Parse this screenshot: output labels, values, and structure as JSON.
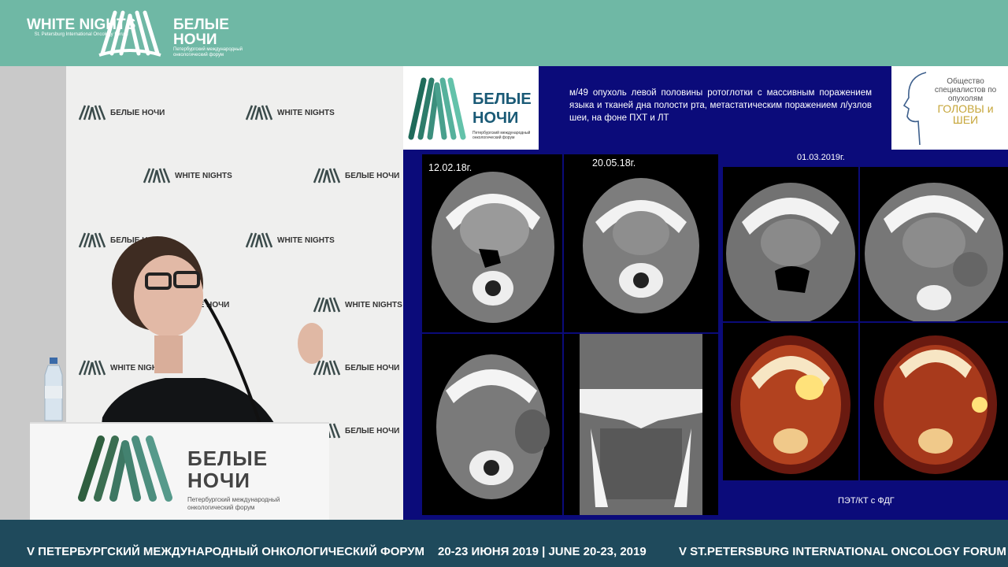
{
  "header": {
    "logo_wn_title": "WHITE NIGHTS",
    "logo_wn_subtitle": "St. Petersburg International Oncology Forum",
    "logo_bn_title": "БЕЛЫЕ НОЧИ",
    "logo_bn_subtitle": "Петербургский международный онкологический форум"
  },
  "stage": {
    "wall_logos": [
      "БЕЛЫЕ НОЧИ",
      "WHITE NIGHTS",
      "WHITE NIGHTS",
      "БЕЛЫЕ НОЧИ",
      "БЕЛЫЕ НОЧИ",
      "WHITE NIGHTS",
      "WHITE NIGHTS",
      "БЕЛЫЕ НОЧИ",
      "WHITE NIGHTS",
      "БЕЛЫЕ НОЧИ",
      "БЕЛЫЕ НОЧИ"
    ],
    "podium_title": "БЕЛЫЕ НОЧИ",
    "podium_subtitle": "Петербургский международный онкологический форум"
  },
  "slide": {
    "logo_title": "БЕЛЫЕ НОЧИ",
    "logo_subtitle": "Петербургский международный онкологический форум",
    "description": "м/49 опухоль левой половины ротоглотки с массивным поражением языка и тканей дна полости рта, метастатическим поражением л/узлов шеи, на фоне ПХТ и ЛТ",
    "society_line1": "Общество специалистов по опухолям",
    "society_line2": "ГОЛОВЫ и ШЕИ",
    "scan_date_1": "12.02.18г.",
    "scan_date_2": "20.05.18г.",
    "scan_date_3": "01.03.2019г.",
    "pet_caption": "ПЭТ/КТ с ФДГ"
  },
  "footer": {
    "left": "V ПЕТЕРБУРГСКИЙ МЕЖДУНАРОДНЫЙ ОНКОЛОГИЧЕСКИЙ ФОРУМ",
    "center": "20-23 ИЮНЯ 2019 | JUNE 20-23, 2019",
    "right": "V ST.PETERSBURG INTERNATIONAL ONCOLOGY FORUM"
  },
  "colors": {
    "header_bg": "#6fb8a5",
    "footer_bg": "#1f4a5c",
    "slide_bg": "#0b0b7a"
  }
}
